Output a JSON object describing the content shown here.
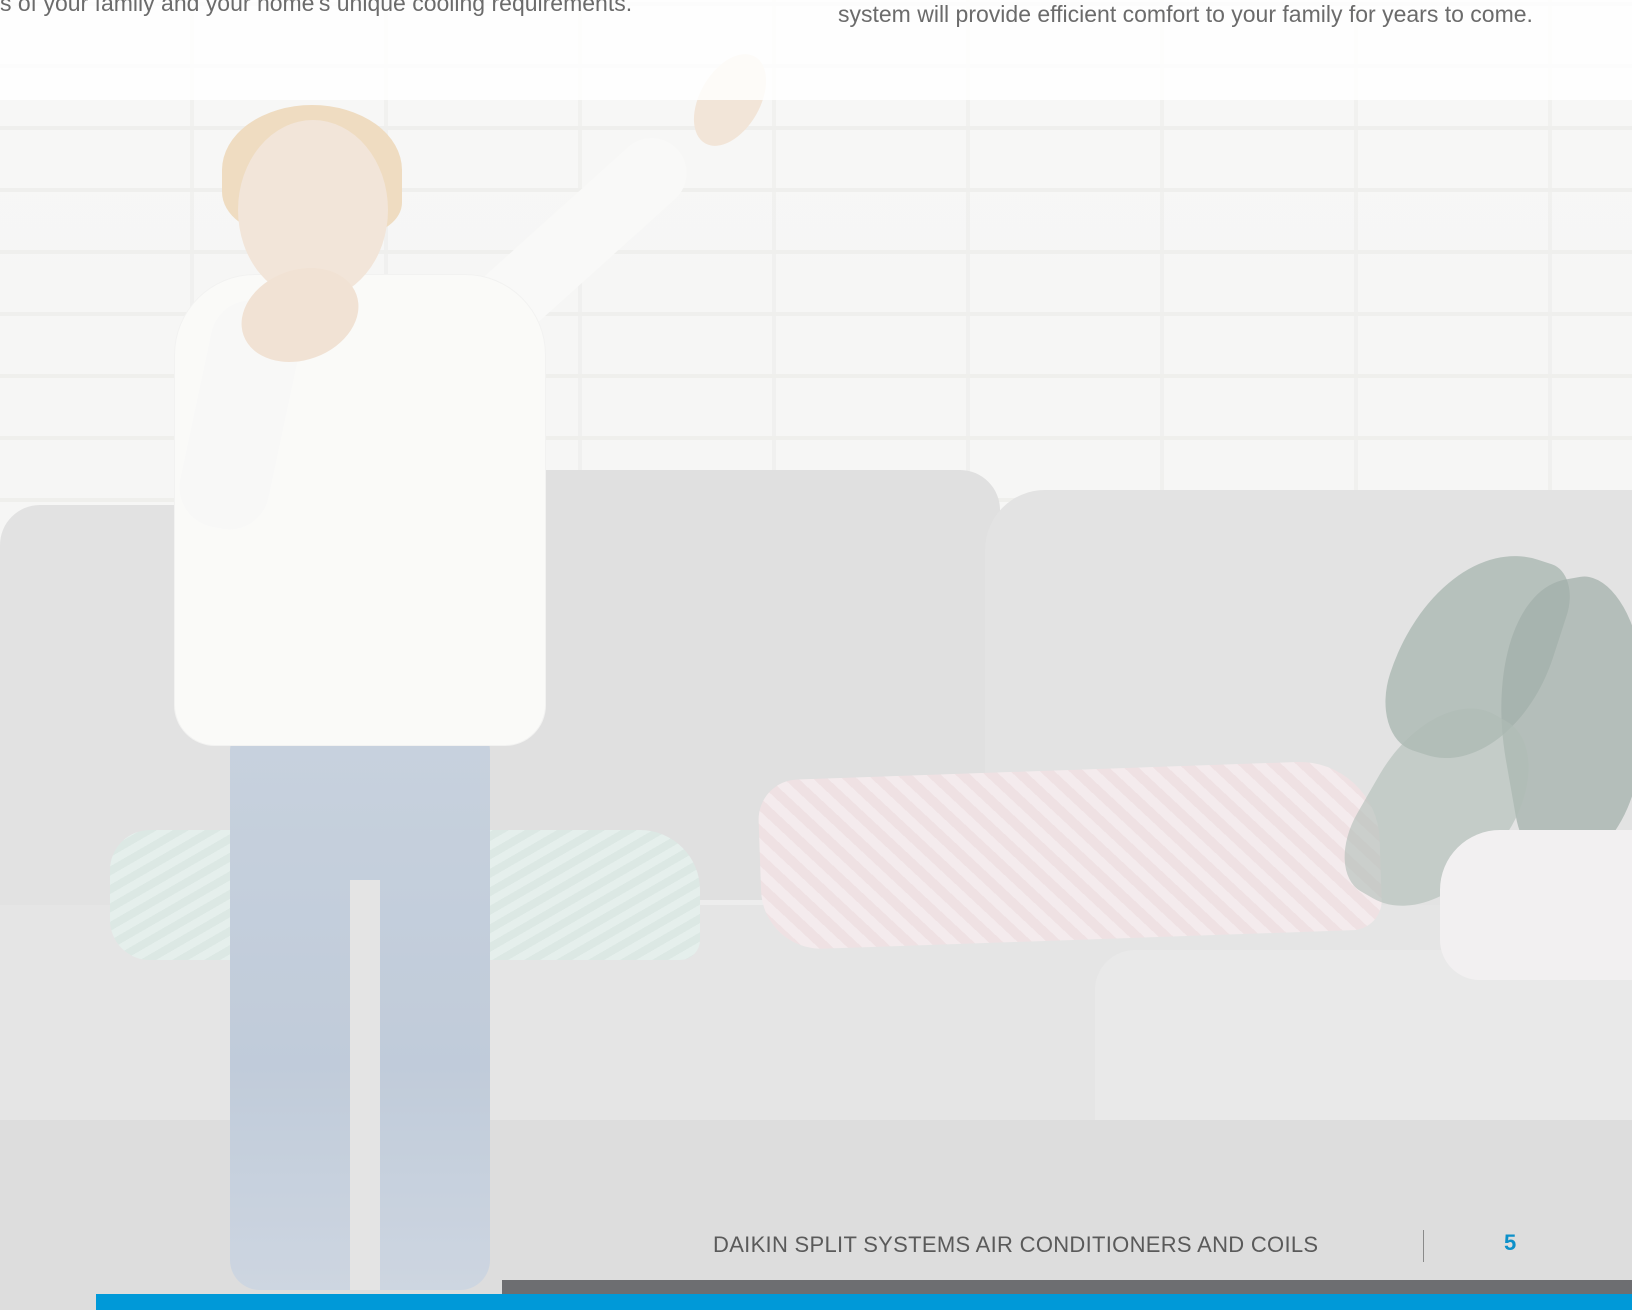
{
  "intro": {
    "left_fragment": "s of your family and your home's unique cooling requirements.",
    "right_paragraph": "system will provide efficient comfort to your family for years to come."
  },
  "footer": {
    "title": "DAIKIN SPLIT SYSTEMS AIR CONDITIONERS AND COILS",
    "page_number": "5"
  },
  "colors": {
    "accent_blue": "#0099d8",
    "page_number": "#0c90c9",
    "bar_gray": "#6d6e71",
    "body_text": "#6b6b6b"
  }
}
